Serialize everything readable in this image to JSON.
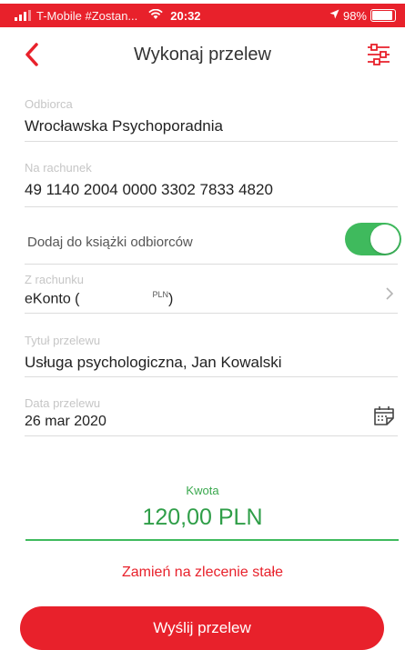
{
  "status_bar": {
    "carrier": "T-Mobile #Zostan...",
    "time": "20:32",
    "battery": "98%",
    "wifi_icon": "wifi-icon",
    "location_icon": "location-arrow-icon"
  },
  "nav": {
    "title": "Wykonaj przelew",
    "back_icon": "chevron-left-icon",
    "filter_icon": "sliders-icon"
  },
  "form": {
    "recipient": {
      "label": "Odbiorca",
      "value": "Wrocławska Psychoporadnia"
    },
    "account": {
      "label": "Na rachunek",
      "value": "49 1140 2004 0000 3302 7833 4820"
    },
    "add_to_book": {
      "label": "Dodaj do książki odbiorców",
      "enabled": true
    },
    "from_account": {
      "label": "Z rachunku",
      "value_prefix": "eKonto (",
      "currency": "PLN",
      "value_suffix": ")"
    },
    "title": {
      "label": "Tytuł przelewu",
      "value": "Usługa psychologiczna, Jan Kowalski"
    },
    "date": {
      "label": "Data przelewu",
      "value": "26 mar 2020",
      "icon": "calendar-icon"
    },
    "amount": {
      "label": "Kwota",
      "value": "120,00 PLN"
    }
  },
  "actions": {
    "standing_order": "Zamień na zlecenie stałe",
    "send": "Wyślij przelew"
  },
  "colors": {
    "brand_red": "#e8212b",
    "success_green": "#3fba5d"
  }
}
